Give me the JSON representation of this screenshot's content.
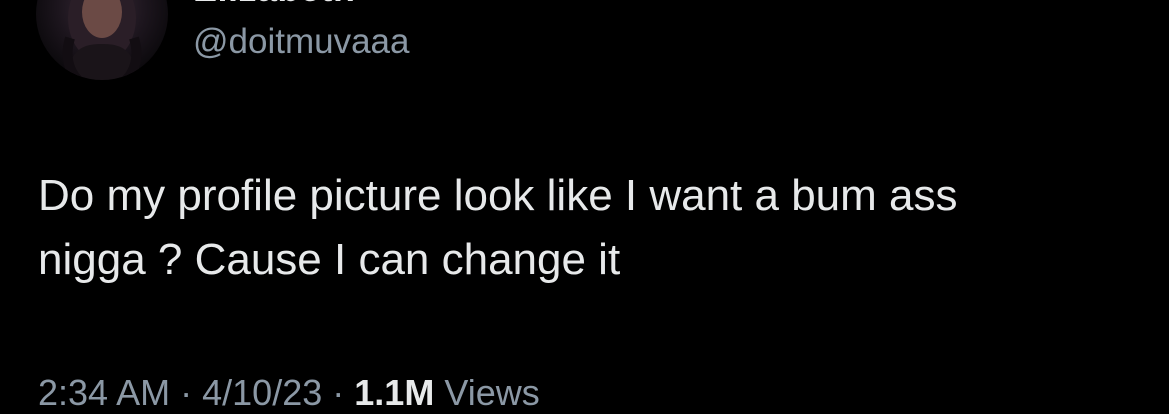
{
  "tweet": {
    "author": {
      "display_name": "Elizabeth",
      "handle": "@doitmuvaaa",
      "avatar_icon": "profile-photo"
    },
    "text_line1": "Do my profile picture look like I want a bum ass",
    "text_line2": "nigga ? Cause I can change it",
    "meta": {
      "time": "2:34 AM",
      "separator": "·",
      "date": "4/10/23",
      "views_count": "1.1M",
      "views_label": "Views"
    }
  },
  "colors": {
    "background": "#000000",
    "primary_text": "#e7e9ea",
    "secondary_text": "#8b98a5"
  }
}
